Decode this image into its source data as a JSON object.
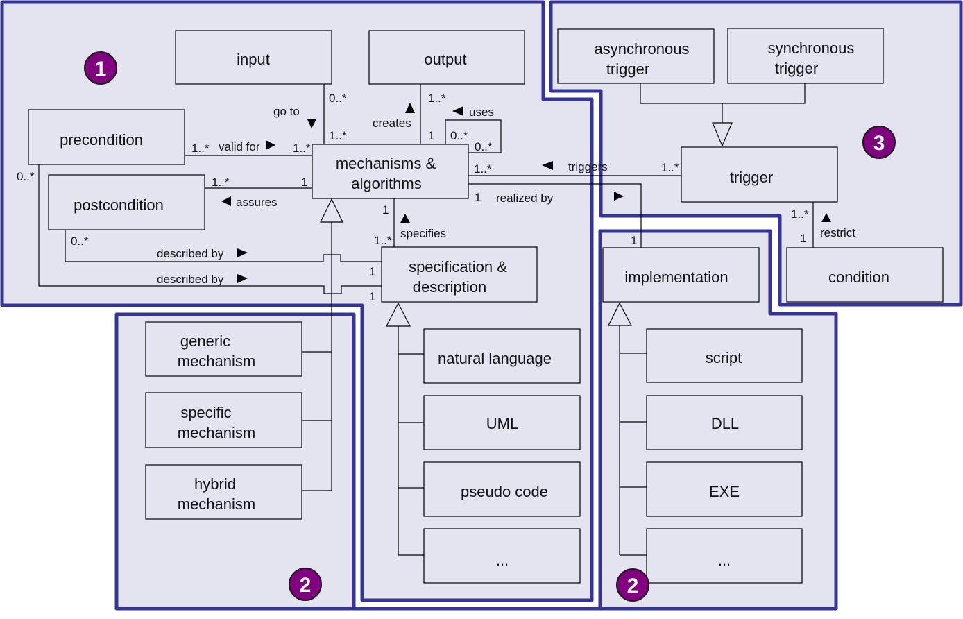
{
  "colors": {
    "region_fill": "#e4e4f0",
    "region_border": "#353597",
    "badge_fill": "#800080",
    "badge_text": "#ffffff"
  },
  "badges": {
    "region1": "1",
    "region2_left": "2",
    "region2_right": "2",
    "region3": "3"
  },
  "classes": {
    "input": [
      "input"
    ],
    "output": [
      "output"
    ],
    "precondition": [
      "precondition"
    ],
    "postcondition": [
      "postcondition"
    ],
    "mechanisms": [
      "mechanisms &",
      "algorithms"
    ],
    "specification": [
      "specification &",
      "description"
    ],
    "async_trigger": [
      "asynchronous",
      "trigger"
    ],
    "sync_trigger": [
      "synchronous",
      "trigger"
    ],
    "trigger": [
      "trigger"
    ],
    "condition": [
      "condition"
    ],
    "implementation": [
      "implementation"
    ],
    "generic_mechanism": [
      "generic",
      "mechanism"
    ],
    "specific_mechanism": [
      "specific",
      "mechanism"
    ],
    "hybrid_mechanism": [
      "hybrid",
      "mechanism"
    ],
    "natural_language": [
      "natural language"
    ],
    "uml": [
      "UML"
    ],
    "pseudo_code": [
      "pseudo code"
    ],
    "spec_other": [
      "..."
    ],
    "script": [
      "script"
    ],
    "dll": [
      "DLL"
    ],
    "exe": [
      "EXE"
    ],
    "impl_other": [
      "..."
    ]
  },
  "associations": {
    "go_to": {
      "label": "go to",
      "mult_input": "0..*",
      "mult_mechanisms": "1..*",
      "arrow": "down"
    },
    "creates": {
      "label": "creates",
      "mult_output": "1..*",
      "mult_mechanisms": "1",
      "arrow": "up"
    },
    "uses": {
      "label": "uses",
      "mult_a": "0..*",
      "mult_b": "0..*",
      "arrow": "left"
    },
    "valid_for": {
      "label": "valid for",
      "mult_precondition": "1..*",
      "mult_mechanisms": "1..*",
      "arrow": "right"
    },
    "assures": {
      "label": "assures",
      "mult_postcondition": "1..*",
      "mult_mechanisms": "1",
      "arrow": "left"
    },
    "triggers": {
      "label": "triggers",
      "mult_mechanisms": "1..*",
      "mult_trigger": "1..*",
      "arrow": "left"
    },
    "realized_by": {
      "label": "realized by",
      "mult_mechanisms": "1",
      "mult_implementation": "1",
      "arrow": "right"
    },
    "specifies": {
      "label": "specifies",
      "mult_mechanisms": "1",
      "mult_specification": "1..*",
      "arrow": "up"
    },
    "described_by_post": {
      "label": "described by",
      "mult_postcondition": "0..*",
      "mult_specification": "1",
      "arrow": "right"
    },
    "described_by_pre": {
      "label": "described by",
      "mult_precondition": "0..*",
      "mult_specification": "1",
      "arrow": "right"
    },
    "restrict": {
      "label": "restrict",
      "mult_trigger": "1..*",
      "mult_condition": "1",
      "arrow": "up"
    }
  }
}
